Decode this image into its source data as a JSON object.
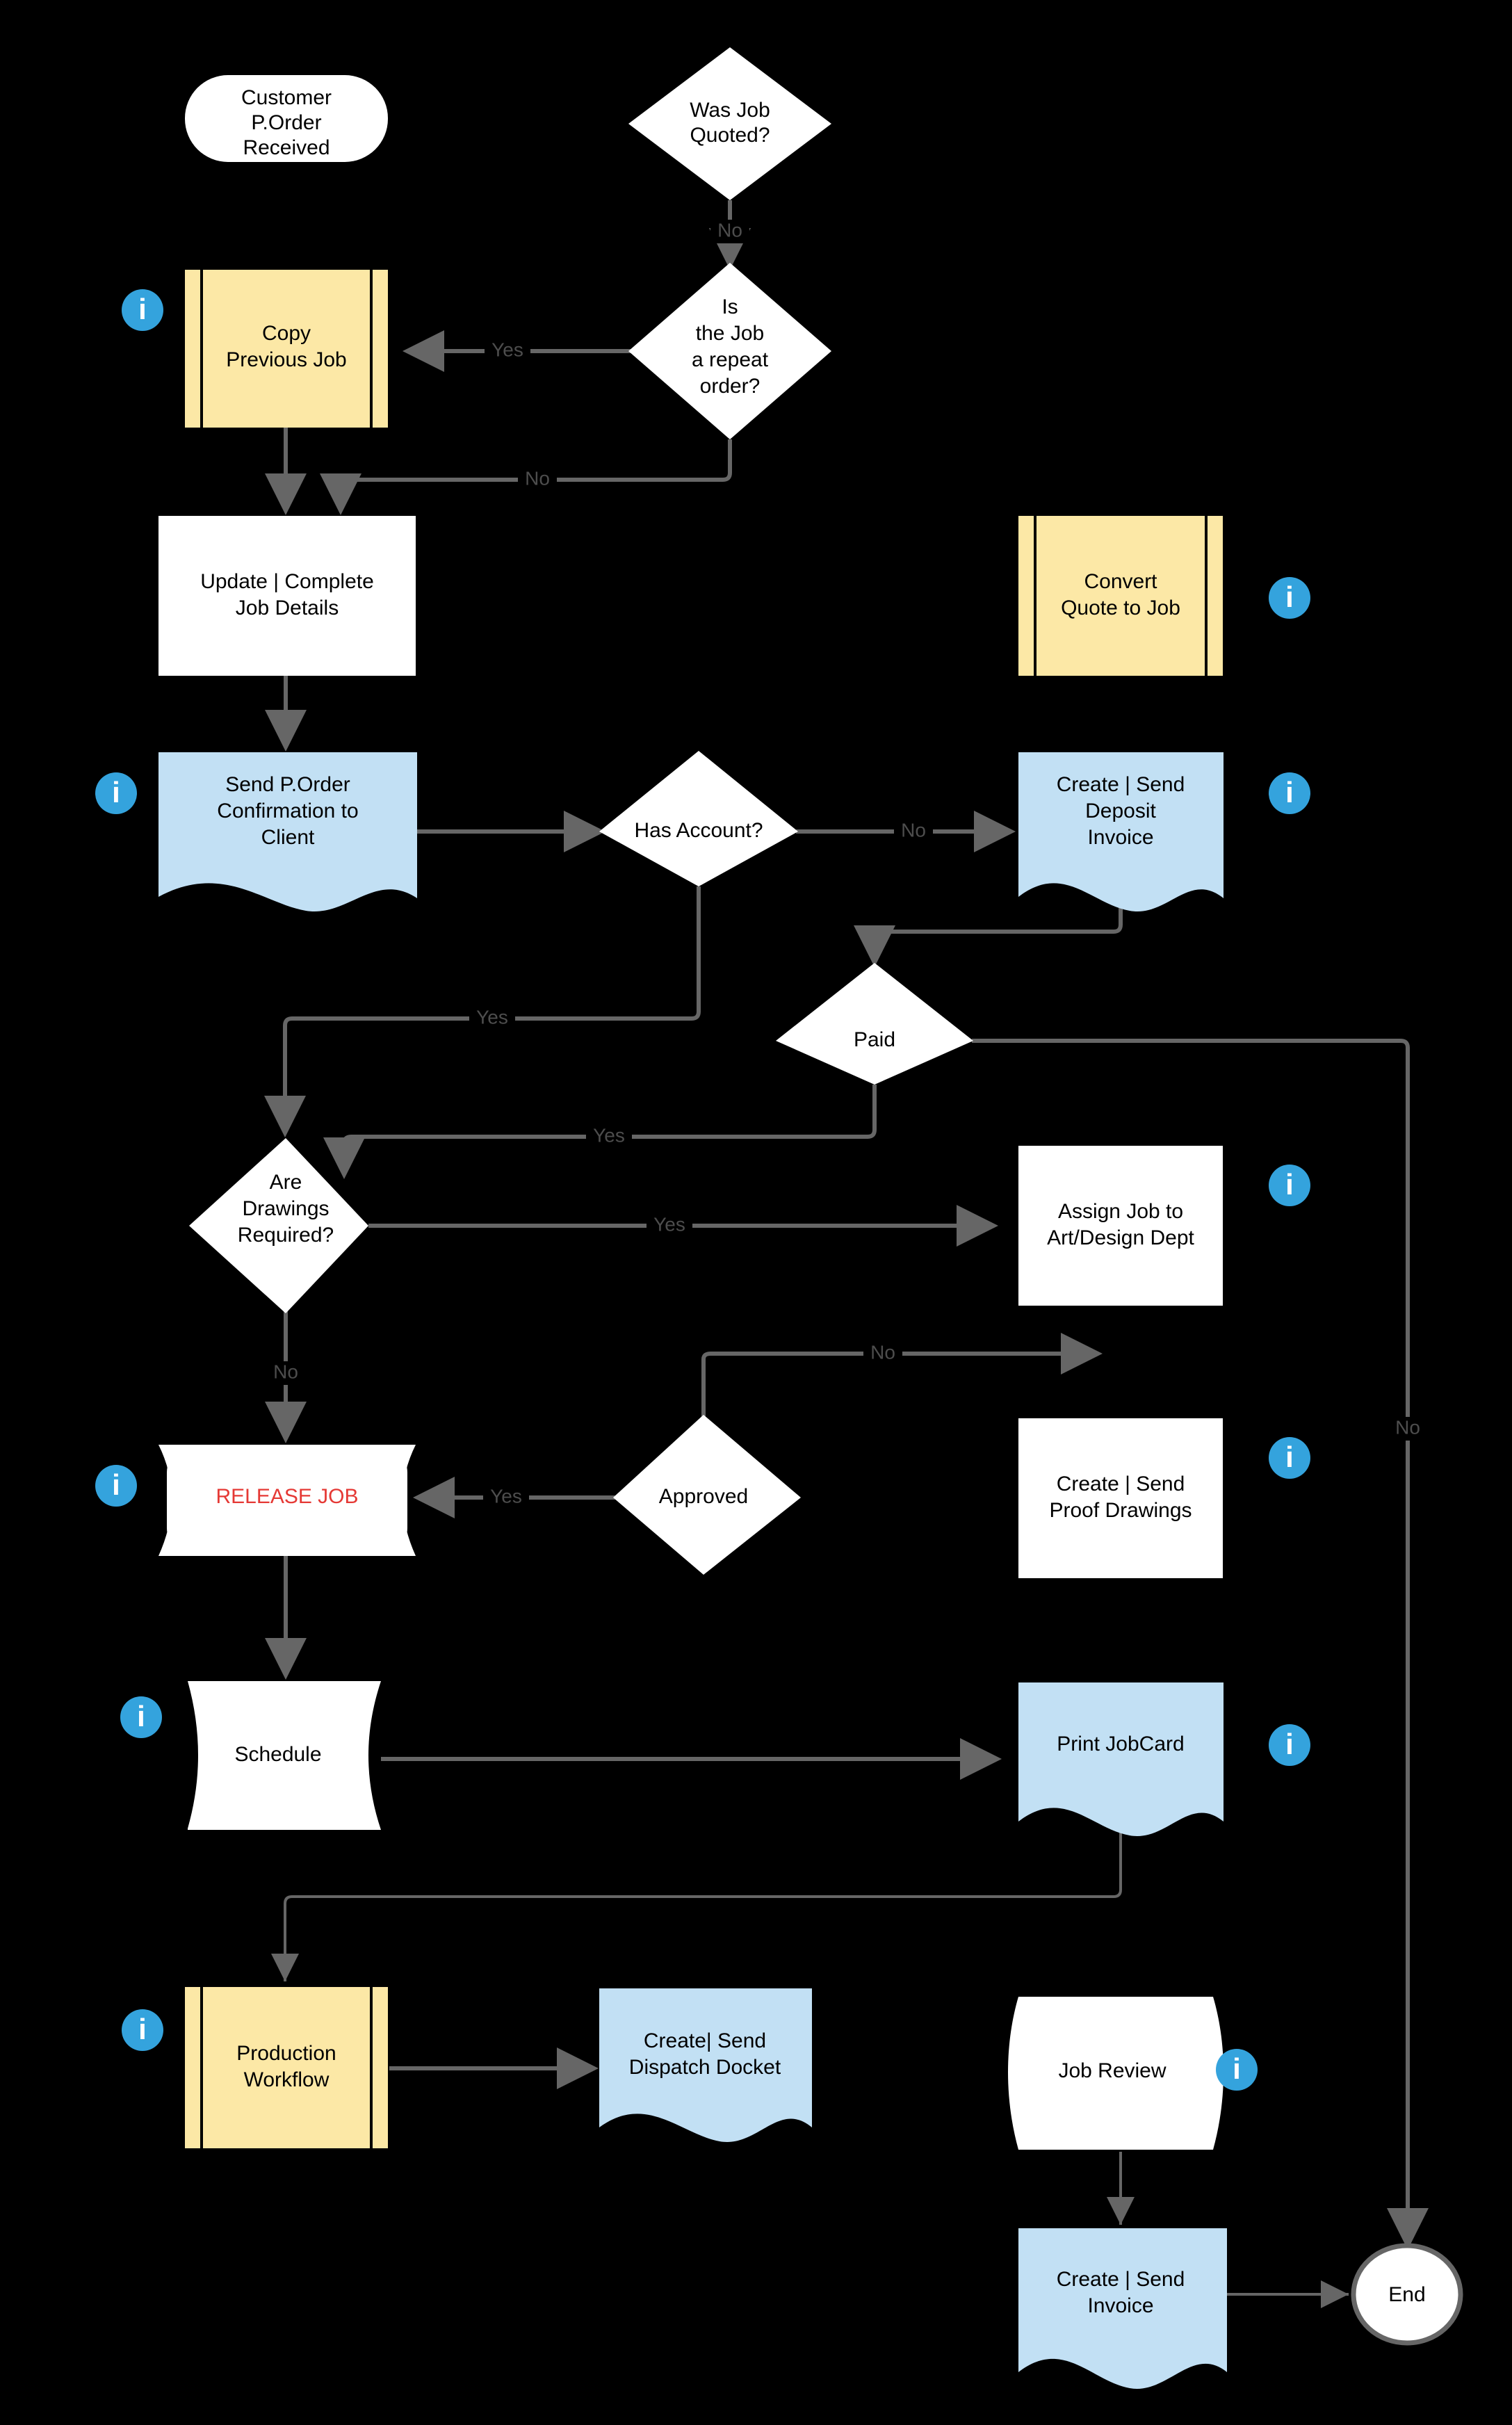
{
  "diagram": {
    "title": "Job Workflow Flowchart",
    "background_color": "#000000",
    "colors": {
      "yellow_process": "#FCE8A6",
      "blue_document": "#C2E0F4",
      "white_shape": "#FFFFFF",
      "edge": "#666666",
      "info_badge": "#34A3DD",
      "release_text": "#E53935"
    }
  },
  "nodes": {
    "customer_po_received": "Customer\nP.Order\nReceived",
    "customer_po_received_lines": [
      "Customer",
      "P.Order",
      "Received"
    ],
    "was_job_quoted": [
      "Was Job",
      "Quoted?"
    ],
    "copy_previous_job": [
      "Copy",
      "Previous Job"
    ],
    "is_job_repeat_order": [
      "Is",
      "the Job",
      "a repeat",
      "order?"
    ],
    "update_complete_job_details": [
      "Update | Complete",
      "Job Details"
    ],
    "convert_quote_to_job": [
      "Convert",
      "Quote to Job"
    ],
    "send_po_confirmation": [
      "Send P.Order",
      "Confirmation to",
      "Client"
    ],
    "has_account": [
      "Has Account?"
    ],
    "create_send_deposit_invoice": [
      "Create | Send",
      "Deposit",
      "Invoice"
    ],
    "paid": [
      "Paid"
    ],
    "are_drawings_required": [
      "Are",
      "Drawings",
      "Required?"
    ],
    "assign_job_to_art_design": [
      "Assign Job to",
      "Art/Design Dept"
    ],
    "release_job": [
      "RELEASE JOB"
    ],
    "approved": [
      "Approved"
    ],
    "create_send_proof_drawings": [
      "Create | Send",
      "Proof Drawings"
    ],
    "schedule": [
      "Schedule"
    ],
    "print_jobcard": [
      "Print JobCard"
    ],
    "production_workflow": [
      "Production",
      "Workflow"
    ],
    "create_send_dispatch_docket": [
      "Create| Send",
      "Dispatch Docket"
    ],
    "job_review": [
      "Job Review"
    ],
    "create_send_invoice": [
      "Create | Send",
      "Invoice"
    ],
    "end": [
      "End"
    ]
  },
  "edge_labels": {
    "quoted_no": "No",
    "repeat_yes": "Yes",
    "repeat_no": "No",
    "has_account_no": "No",
    "has_account_yes": "Yes",
    "paid_yes": "Yes",
    "paid_no": "No",
    "drawings_yes": "Yes",
    "drawings_no": "No",
    "approved_yes": "Yes",
    "approved_no": "No"
  },
  "info_badges": {
    "glyph": "i",
    "name": "info-icon",
    "count": 12
  }
}
